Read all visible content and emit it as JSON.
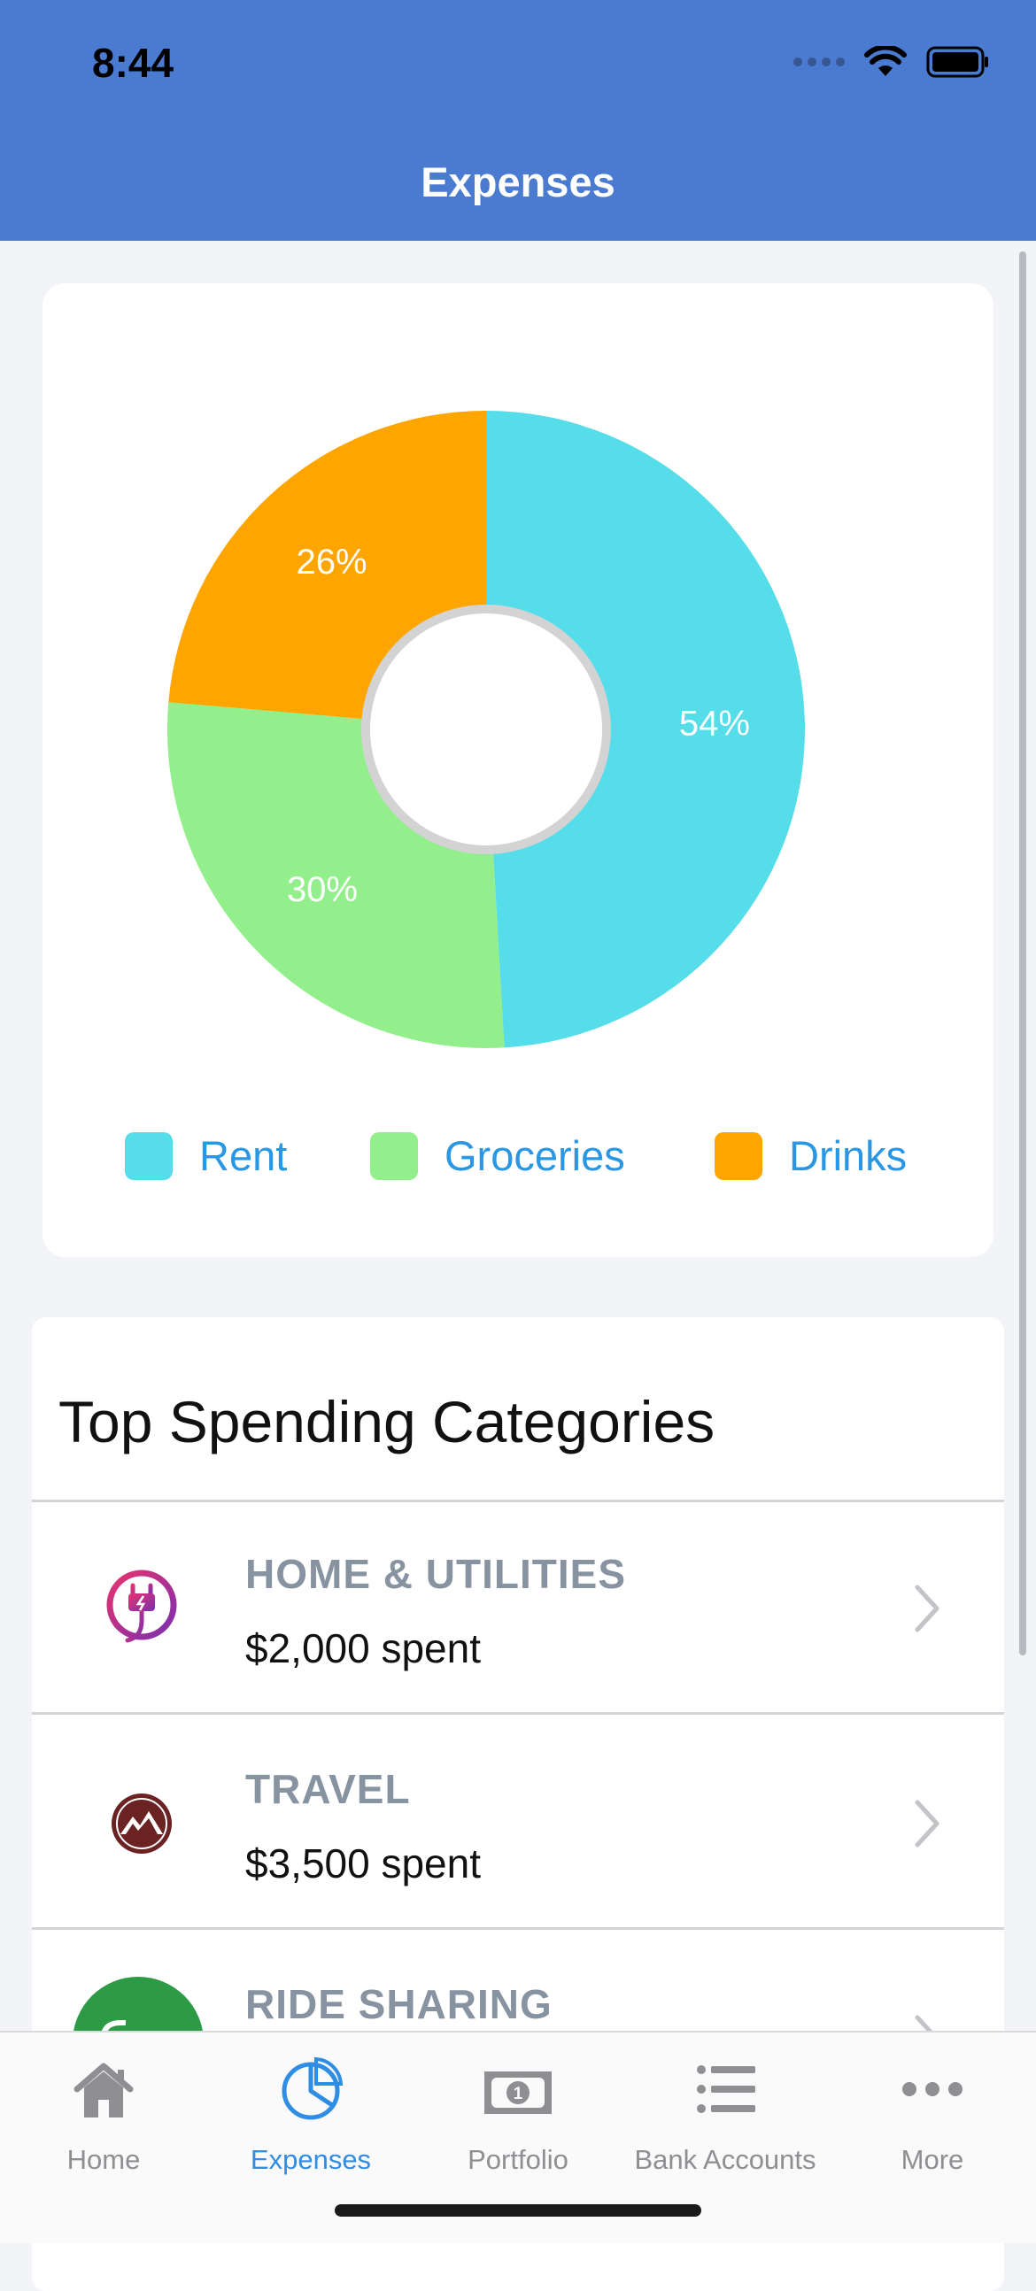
{
  "status": {
    "time": "8:44"
  },
  "header": {
    "title": "Expenses"
  },
  "chart_data": {
    "type": "pie",
    "categories": [
      "Rent",
      "Groceries",
      "Drinks"
    ],
    "values": [
      54,
      30,
      26
    ],
    "labels": [
      "54%",
      "30%",
      "26%"
    ],
    "colors": [
      "#55dde9",
      "#93ee8c",
      "#ffa500"
    ],
    "donut": true,
    "legend": "bottom"
  },
  "legend": {
    "items": [
      {
        "label": "Rent",
        "color": "#55dde9"
      },
      {
        "label": "Groceries",
        "color": "#93ee8c"
      },
      {
        "label": "Drinks",
        "color": "#ffa500"
      }
    ]
  },
  "categories_card": {
    "title": "Top Spending Categories",
    "items": [
      {
        "name": "HOME & UTILITIES",
        "spent": "$2,000 spent",
        "icon": "plug-icon"
      },
      {
        "name": "TRAVEL",
        "spent": "$3,500 spent",
        "icon": "mountain-icon"
      },
      {
        "name": "RIDE SHARING",
        "spent": "",
        "icon": "grab-logo-icon"
      }
    ]
  },
  "tabbar": {
    "tabs": [
      {
        "label": "Home",
        "icon": "home-icon",
        "active": false
      },
      {
        "label": "Expenses",
        "icon": "pie-chart-icon",
        "active": true
      },
      {
        "label": "Portfolio",
        "icon": "banknote-icon",
        "active": false
      },
      {
        "label": "Bank Accounts",
        "icon": "list-icon",
        "active": false
      },
      {
        "label": "More",
        "icon": "more-icon",
        "active": false
      }
    ]
  },
  "colors": {
    "header": "#4a7bd0",
    "accent": "#2f8de4",
    "legend_text": "#2997e3"
  }
}
